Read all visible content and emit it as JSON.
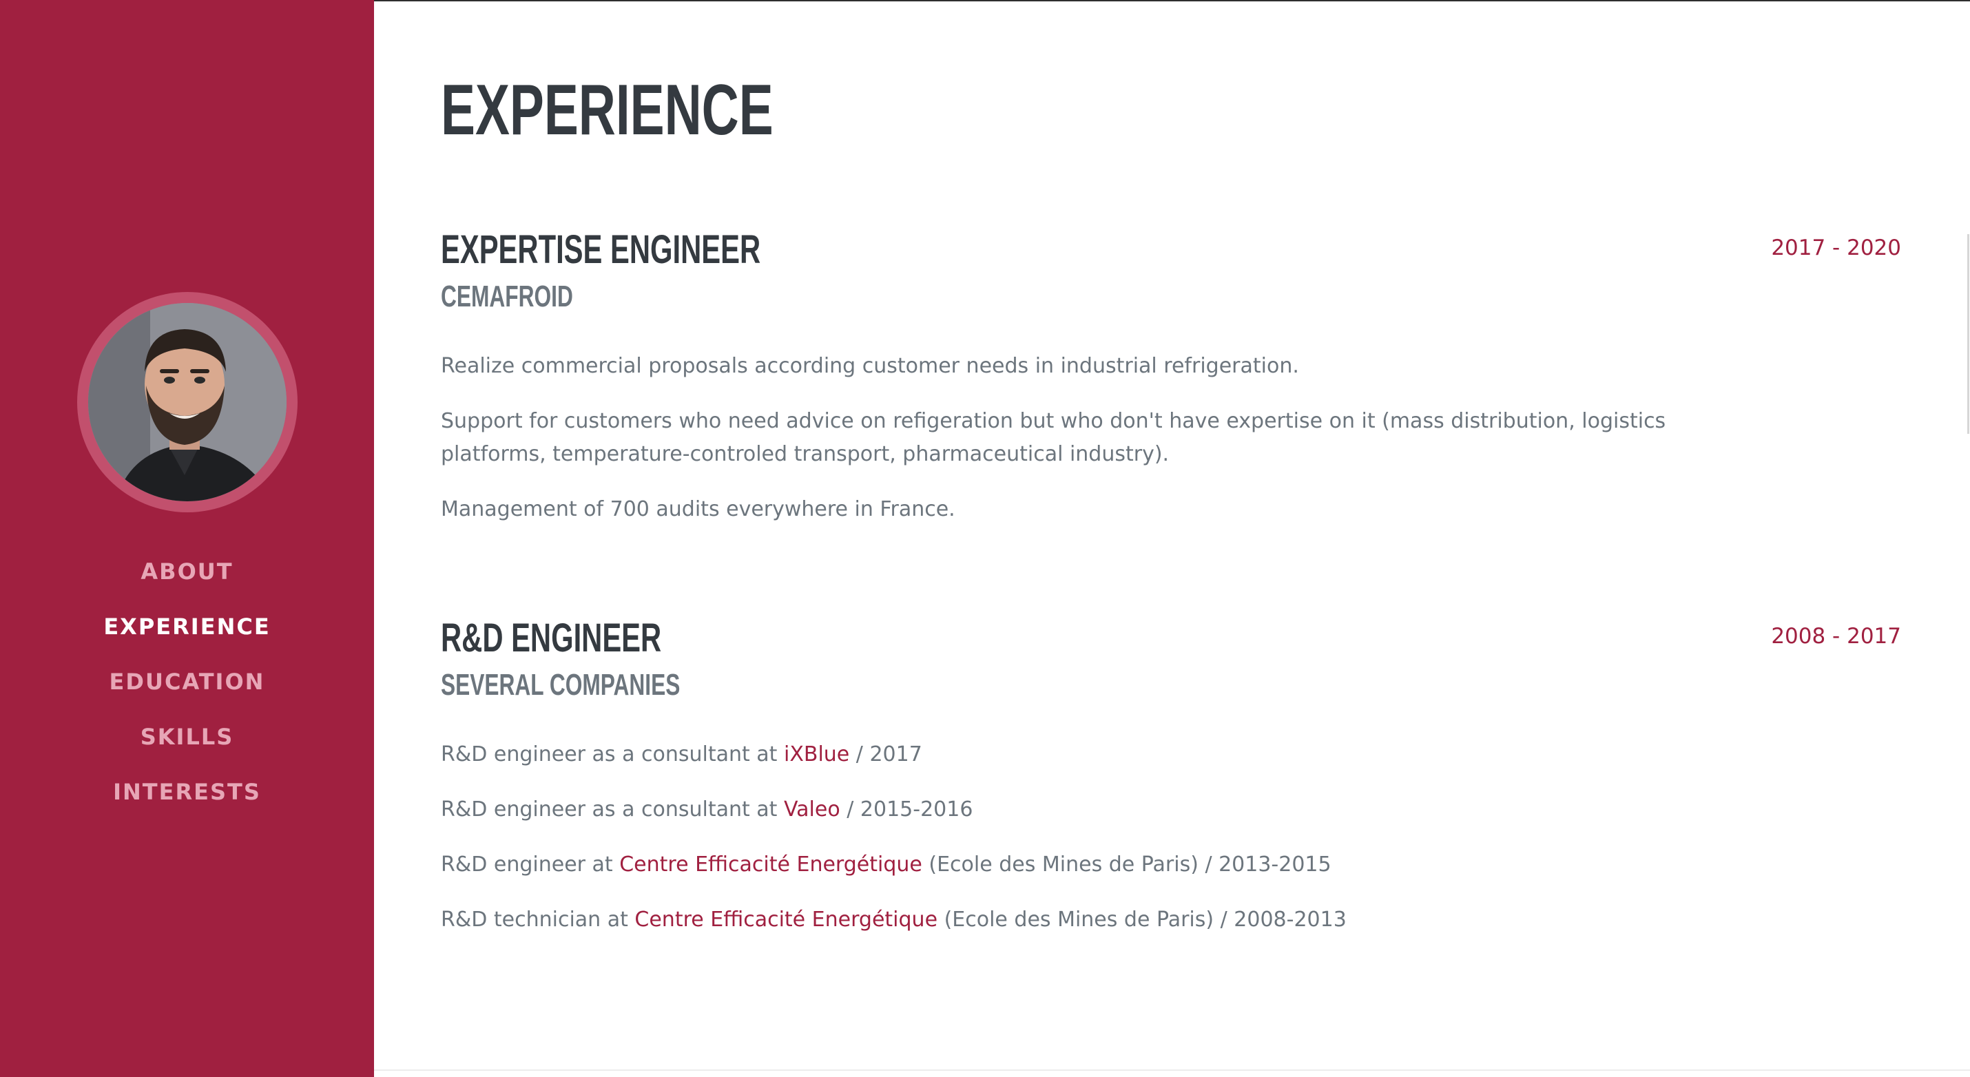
{
  "sidebar": {
    "accent_color": "#a02040",
    "avatar_alt": "profile-photo",
    "nav": [
      {
        "label": "ABOUT",
        "active": false
      },
      {
        "label": "EXPERIENCE",
        "active": true
      },
      {
        "label": "EDUCATION",
        "active": false
      },
      {
        "label": "SKILLS",
        "active": false
      },
      {
        "label": "INTERESTS",
        "active": false
      }
    ]
  },
  "main": {
    "title": "EXPERIENCE",
    "jobs": [
      {
        "title": "EXPERTISE ENGINEER",
        "company": "CEMAFROID",
        "dates": "2017 - 2020",
        "description": [
          "Realize commercial proposals according customer needs in industrial refrigeration.",
          "Support for customers who need advice on refigeration but who don't have expertise on it (mass distribution, logistics platforms, temperature-controled transport, pharmaceutical industry).",
          "Management of 700 audits everywhere in France."
        ]
      },
      {
        "title": "R&D ENGINEER",
        "company": "SEVERAL COMPANIES",
        "dates": "2008 - 2017",
        "description": [
          {
            "before": "R&D engineer as a consultant at ",
            "link": "iXBlue",
            "after": " / 2017"
          },
          {
            "before": "R&D engineer as a consultant at ",
            "link": "Valeo",
            "after": " / 2015-2016"
          },
          {
            "before": "R&D engineer at ",
            "link": "Centre Efficacité Energétique",
            "after": " (Ecole des Mines de Paris) / 2013-2015"
          },
          {
            "before": "R&D technician at ",
            "link": "Centre Efficacité Energétique",
            "after": " (Ecole des Mines de Paris) / 2008-2013"
          }
        ]
      }
    ]
  }
}
